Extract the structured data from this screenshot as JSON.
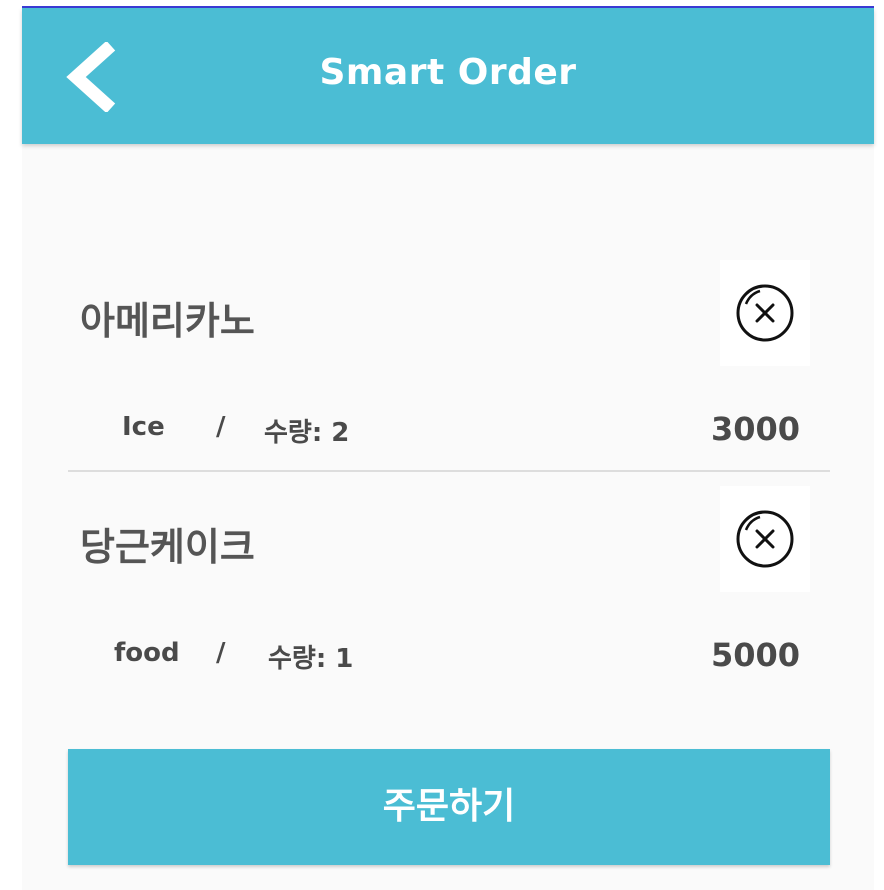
{
  "header": {
    "title": "Smart Order",
    "back_icon": "chevron-left-icon"
  },
  "order_items": [
    {
      "name": "아메리카노",
      "option": "Ice",
      "separator": "/",
      "quantity_label": "수량: 2",
      "price": "3000",
      "remove_icon": "close-circle-icon"
    },
    {
      "name": "당근케이크",
      "option": "food",
      "separator": "/",
      "quantity_label": "수량: 1",
      "price": "5000",
      "remove_icon": "close-circle-icon"
    }
  ],
  "order_button": {
    "label": "주문하기"
  },
  "colors": {
    "accent": "#4bbdd4",
    "background": "#fafafa",
    "text": "#4a4a4a"
  }
}
